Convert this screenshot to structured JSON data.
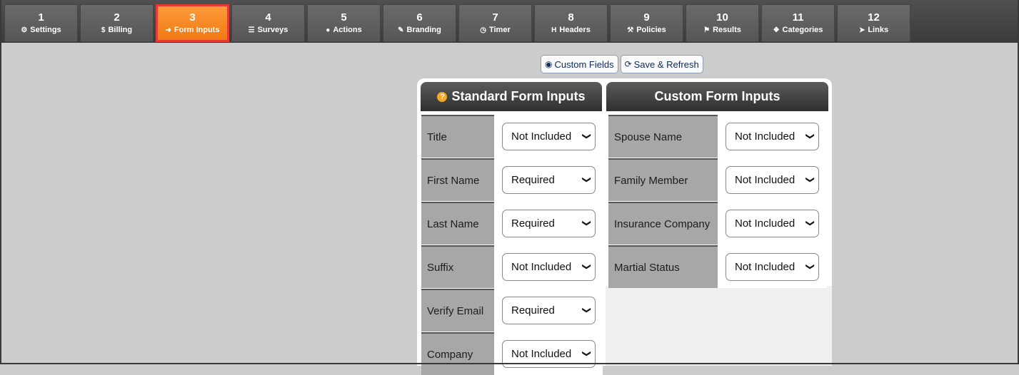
{
  "tabs": [
    {
      "num": "1",
      "label": "Settings",
      "icon": "⚙",
      "icon_name": "gear-icon"
    },
    {
      "num": "2",
      "label": "Billing",
      "icon": "$",
      "icon_name": "dollar-icon"
    },
    {
      "num": "3",
      "label": "Form Inputs",
      "icon": "➜",
      "icon_name": "sign-in-icon"
    },
    {
      "num": "4",
      "label": "Surveys",
      "icon": "☰",
      "icon_name": "list-icon"
    },
    {
      "num": "5",
      "label": "Actions",
      "icon": "●",
      "icon_name": "user-icon"
    },
    {
      "num": "6",
      "label": "Branding",
      "icon": "✎",
      "icon_name": "brush-icon"
    },
    {
      "num": "7",
      "label": "Timer",
      "icon": "◷",
      "icon_name": "clock-icon"
    },
    {
      "num": "8",
      "label": "Headers",
      "icon": "H",
      "icon_name": "header-icon"
    },
    {
      "num": "9",
      "label": "Policies",
      "icon": "⚒",
      "icon_name": "gavel-icon"
    },
    {
      "num": "10",
      "label": "Results",
      "icon": "⚑",
      "icon_name": "flag-icon"
    },
    {
      "num": "11",
      "label": "Categories",
      "icon": "❖",
      "icon_name": "cubes-icon"
    },
    {
      "num": "12",
      "label": "Links",
      "icon": "➤",
      "icon_name": "pointer-icon"
    }
  ],
  "active_tab": "3",
  "toolbar": {
    "custom_fields_label": "Custom Fields",
    "custom_fields_icon": "◉",
    "save_refresh_label": "Save & Refresh",
    "save_refresh_icon": "⟳"
  },
  "standard": {
    "title": "Standard Form Inputs",
    "help_icon": "?",
    "rows": [
      {
        "label": "Title",
        "value": "Not Included"
      },
      {
        "label": "First Name",
        "value": "Required"
      },
      {
        "label": "Last Name",
        "value": "Required"
      },
      {
        "label": "Suffix",
        "value": "Not Included"
      },
      {
        "label": "Verify Email",
        "value": "Required"
      },
      {
        "label": "Company",
        "value": "Not Included"
      }
    ]
  },
  "custom": {
    "title": "Custom Form Inputs",
    "rows": [
      {
        "label": "Spouse Name",
        "value": "Not Included"
      },
      {
        "label": "Family Member",
        "value": "Not Included"
      },
      {
        "label": "Insurance Company",
        "value": "Not Included"
      },
      {
        "label": "Martial Status",
        "value": "Not Included"
      }
    ]
  },
  "colors": {
    "active_tab": "#f28a22",
    "active_border": "#e83a35",
    "header_dark": "#3a3a3a",
    "label_bg": "#a9a7a5"
  }
}
